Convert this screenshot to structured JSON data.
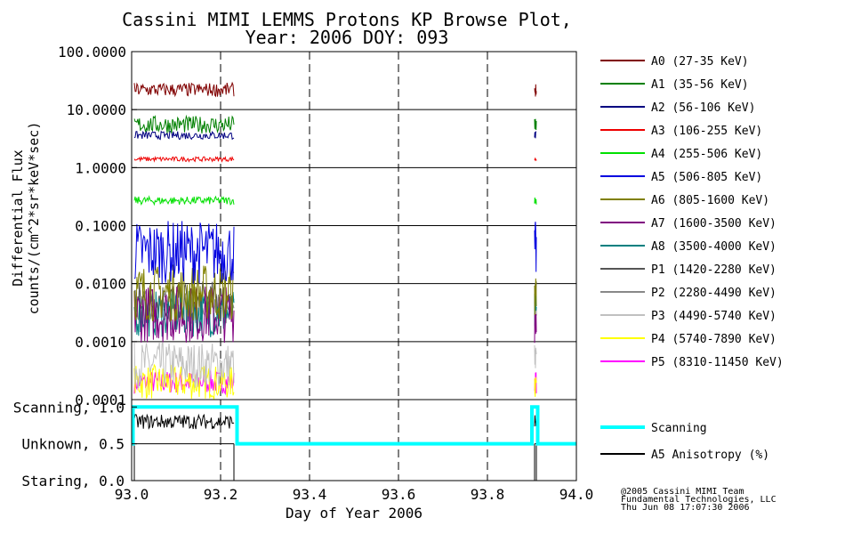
{
  "title_line1": "Cassini MIMI LEMMS Protons KP Browse Plot,",
  "title_line2": "Year: 2006 DOY: 093",
  "ylabel_line1": "Differential Flux",
  "ylabel_line2": "counts/(cm^2*sr*keV*sec)",
  "xlabel": "Day of Year 2006",
  "footer": [
    "@2005 Cassini MIMI Team",
    "Fundamental Technologies, LLC",
    "Thu Jun 08 17:07:30 2006"
  ],
  "chart_data": {
    "type": "line",
    "title": "Cassini MIMI LEMMS Protons KP Browse Plot, Year: 2006 DOY: 093",
    "xlabel": "Day of Year 2006",
    "ylabel": "Differential Flux counts/(cm^2*sr*keV*sec)",
    "xlim": [
      93.0,
      94.0
    ],
    "x_ticks": [
      "93.0",
      "93.2",
      "93.4",
      "93.6",
      "93.8",
      "94.0"
    ],
    "upper_panel": {
      "yscale": "log",
      "ylim": [
        0.0001,
        100
      ],
      "y_ticks": [
        "100.0000",
        "10.0000",
        "1.0000",
        "0.1000",
        "0.0100",
        "0.0010",
        "0.0001"
      ],
      "grid": true,
      "data_intervals": [
        [
          93.0,
          93.23
        ],
        [
          93.9,
          93.91
        ]
      ],
      "series": [
        {
          "name": "A0 (27-35 KeV)",
          "color": "#800000",
          "typical": 22,
          "spread_decades": 0.12
        },
        {
          "name": "A1 (35-56 KeV)",
          "color": "#008000",
          "typical": 5.5,
          "spread_decades": 0.15
        },
        {
          "name": "A2 (56-106 KeV)",
          "color": "#000080",
          "typical": 3.6,
          "spread_decades": 0.07
        },
        {
          "name": "A3 (106-255 KeV)",
          "color": "#ee0000",
          "typical": 1.4,
          "spread_decades": 0.04
        },
        {
          "name": "A4 (255-506 KeV)",
          "color": "#00e000",
          "typical": 0.27,
          "spread_decades": 0.07
        },
        {
          "name": "A5 (506-805 KeV)",
          "color": "#0000e0",
          "typical": 0.035,
          "spread_decades": 0.55
        },
        {
          "name": "A6 (805-1600 KeV)",
          "color": "#808000",
          "typical": 0.007,
          "spread_decades": 0.5
        },
        {
          "name": "A7 (1600-3500 KeV)",
          "color": "#800080",
          "typical": 0.003,
          "spread_decades": 0.5
        },
        {
          "name": "A8 (3500-4000 KeV)",
          "color": "#008080",
          "typical": 0.003,
          "spread_decades": 0.4
        },
        {
          "name": "P1 (1420-2280 KeV)",
          "color": "#555555",
          "typical": 0.005,
          "spread_decades": 0.35
        },
        {
          "name": "P2 (2280-4490 KeV)",
          "color": "#888888",
          "typical": 0.004,
          "spread_decades": 0.3
        },
        {
          "name": "P3 (4490-5740 KeV)",
          "color": "#c0c0c0",
          "typical": 0.0004,
          "spread_decades": 0.4
        },
        {
          "name": "P4 (5740-7890 KeV)",
          "color": "#ffff00",
          "typical": 0.0002,
          "spread_decades": 0.3
        },
        {
          "name": "P5 (8310-11450 KeV)",
          "color": "#ff00ff",
          "typical": 0.0002,
          "spread_decades": 0.2
        }
      ]
    },
    "lower_panel": {
      "ylim": [
        0.0,
        1.1
      ],
      "y_ticks": [
        {
          "label": "Scanning, 1.0",
          "value": 1.0
        },
        {
          "label": "Unknown, 0.5",
          "value": 0.5
        },
        {
          "label": "Staring, 0.0",
          "value": 0.0
        }
      ],
      "series": [
        {
          "name": "Scanning",
          "color": "#00ffff",
          "x": [
            93.0,
            93.003,
            93.003,
            93.237,
            93.237,
            93.9,
            93.9,
            93.913,
            93.913,
            94.0
          ],
          "y": [
            0.5,
            0.5,
            1.0,
            1.0,
            0.5,
            0.5,
            1.0,
            1.0,
            0.5,
            0.5
          ]
        },
        {
          "name": "A5 Anisotropy (%)",
          "color": "#000000",
          "typical": 0.8,
          "spread": 0.1
        }
      ]
    }
  }
}
